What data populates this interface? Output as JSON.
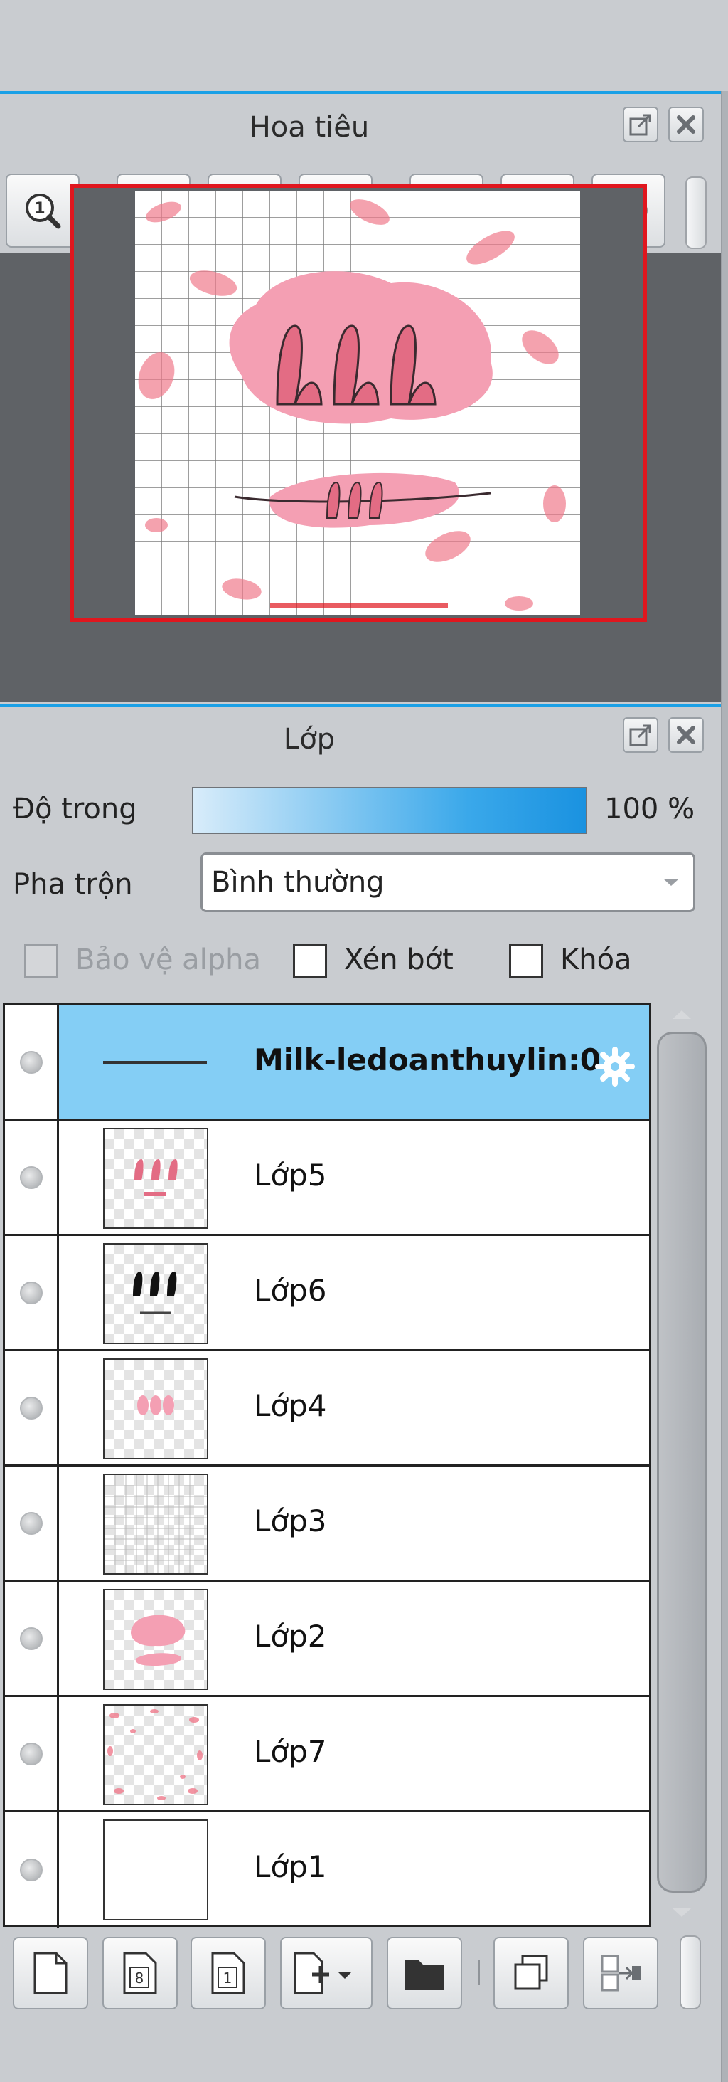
{
  "navigator": {
    "title": "Hoa tiêu",
    "toolbar": [
      {
        "icon": "actual-size-icon"
      },
      {
        "icon": "zoom-in-icon"
      },
      {
        "icon": "fit-to-view-icon"
      },
      {
        "icon": "zoom-out-icon"
      },
      {
        "icon": "rotate-left-icon"
      },
      {
        "icon": "reset-rotation-icon"
      },
      {
        "icon": "rotate-right-icon"
      }
    ],
    "frame_color": "#e0161e"
  },
  "layers_panel": {
    "title": "Lớp",
    "opacity_label": "Độ trong",
    "opacity_value": "100 %",
    "opacity_fraction": 1.0,
    "blend_label": "Pha trộn",
    "blend_value": "Bình thường",
    "protect_alpha_label": "Bảo vệ alpha",
    "clip_label": "Xén bớt",
    "lock_label": "Khóa",
    "protect_alpha_checked": false,
    "clip_checked": false,
    "lock_checked": false,
    "selected_color": "#84cef5",
    "layers": [
      {
        "name": "Milk-ledoanthuylin:0",
        "selected": true
      },
      {
        "name": "Lớp5"
      },
      {
        "name": "Lớp6"
      },
      {
        "name": "Lớp4"
      },
      {
        "name": "Lớp3"
      },
      {
        "name": "Lớp2"
      },
      {
        "name": "Lớp7"
      },
      {
        "name": "Lớp1"
      }
    ],
    "bottom_toolbar": [
      {
        "icon": "new-layer-icon"
      },
      {
        "icon": "new-8bit-layer-icon",
        "text": "8"
      },
      {
        "icon": "new-1bit-layer-icon",
        "text": "1"
      },
      {
        "icon": "add-layer-dropdown-icon"
      },
      {
        "icon": "new-folder-icon"
      },
      {
        "icon": "duplicate-layer-icon"
      },
      {
        "icon": "transfer-layer-icon"
      }
    ]
  }
}
